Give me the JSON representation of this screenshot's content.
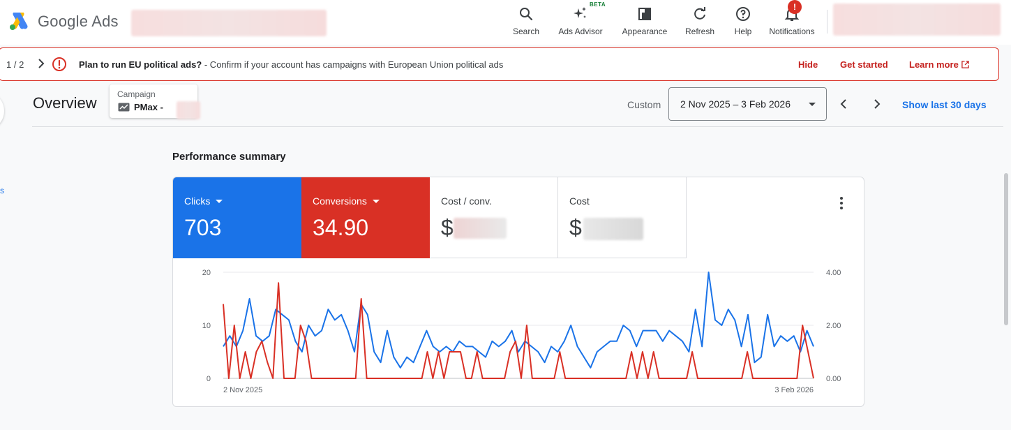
{
  "app": {
    "title": "Google Ads"
  },
  "colors": {
    "accent": "#1a73e8",
    "clicks": "#1a73e8",
    "conversions": "#d93025",
    "warning": "#d93025",
    "link": "#1a73e8"
  },
  "toolbar": {
    "items": [
      {
        "label": "Search",
        "icon": "search-icon"
      },
      {
        "label": "Ads Advisor",
        "icon": "sparkle-icon",
        "badge": "BETA"
      },
      {
        "label": "Appearance",
        "icon": "appearance-icon"
      },
      {
        "label": "Refresh",
        "icon": "refresh-icon"
      },
      {
        "label": "Help",
        "icon": "help-icon"
      },
      {
        "label": "Notifications",
        "icon": "bell-icon",
        "badge": "!"
      }
    ]
  },
  "banner": {
    "count": "1 / 2",
    "title": "Plan to run EU political ads?",
    "message": " - Confirm if your account has campaigns with European Union political ads",
    "hide": "Hide",
    "get_started": "Get started",
    "learn_more": "Learn more"
  },
  "overview": {
    "title": "Overview",
    "campaign_label": "Campaign",
    "campaign_value": "PMax -",
    "range_label": "Custom",
    "date_range": "2 Nov 2025 – 3 Feb 2026",
    "show_last": "Show last 30 days"
  },
  "sidebar": {
    "fragment": "s"
  },
  "performance": {
    "title": "Performance summary",
    "metrics": [
      {
        "label": "Clicks",
        "value": "703"
      },
      {
        "label": "Conversions",
        "value": "34.90"
      },
      {
        "label": "Cost / conv.",
        "value": "$"
      },
      {
        "label": "Cost",
        "value": "$"
      }
    ]
  },
  "chart_data": {
    "type": "line",
    "x_start_label": "2 Nov 2025",
    "x_end_label": "3 Feb 2026",
    "y_left": {
      "ticks": [
        "0",
        "10",
        "20"
      ],
      "range": [
        0,
        20
      ]
    },
    "y_right": {
      "ticks": [
        "0.00",
        "2.00",
        "4.00"
      ],
      "range": [
        0,
        4
      ]
    },
    "grid": true,
    "series": [
      {
        "name": "Clicks",
        "axis": "left",
        "color": "#1a73e8",
        "values": [
          6,
          8,
          6,
          9,
          15,
          8,
          7,
          8,
          13,
          12,
          11,
          7,
          5,
          10,
          8,
          9,
          13,
          11,
          12,
          9,
          5,
          14,
          12,
          5,
          3,
          9,
          4,
          2,
          4,
          3,
          6,
          9,
          6,
          5,
          6,
          5,
          7,
          6,
          6,
          5,
          4,
          7,
          6,
          7,
          9,
          5,
          7,
          6,
          5,
          3,
          6,
          5,
          7,
          10,
          6,
          4,
          2,
          5,
          6,
          7,
          7,
          10,
          9,
          6,
          9,
          9,
          9,
          7,
          9,
          8,
          7,
          5,
          13,
          6,
          20,
          11,
          10,
          13,
          11,
          6,
          12,
          3,
          4,
          12,
          6,
          8,
          7,
          8,
          5,
          9,
          6
        ]
      },
      {
        "name": "Conversions",
        "axis": "right",
        "color": "#d93025",
        "values": [
          2.8,
          0,
          2.0,
          0,
          1.0,
          0,
          1.0,
          1.4,
          0.6,
          0,
          3.6,
          0,
          0,
          0,
          2.0,
          1.4,
          0,
          0,
          0,
          0,
          0,
          0,
          0,
          0,
          0,
          3.0,
          0,
          0,
          0,
          0,
          0,
          0,
          0,
          0,
          0,
          0,
          0,
          1.0,
          0,
          1.0,
          0,
          1.0,
          1.0,
          1.0,
          0,
          0,
          1.0,
          0,
          0,
          0,
          0,
          0,
          1.0,
          1.4,
          0,
          2.0,
          0,
          0,
          0,
          0,
          0,
          1.0,
          0,
          0,
          0,
          0,
          0,
          0,
          0,
          0,
          0,
          0,
          0,
          0,
          1.0,
          0,
          1.0,
          0,
          1.0,
          0,
          0,
          0,
          0,
          0,
          0,
          1.0,
          0,
          0,
          0,
          0,
          0,
          0,
          0,
          0,
          0,
          1.0,
          0,
          0,
          0,
          0,
          0,
          0,
          0,
          0,
          0,
          2.0,
          1.0,
          0
        ]
      }
    ]
  }
}
